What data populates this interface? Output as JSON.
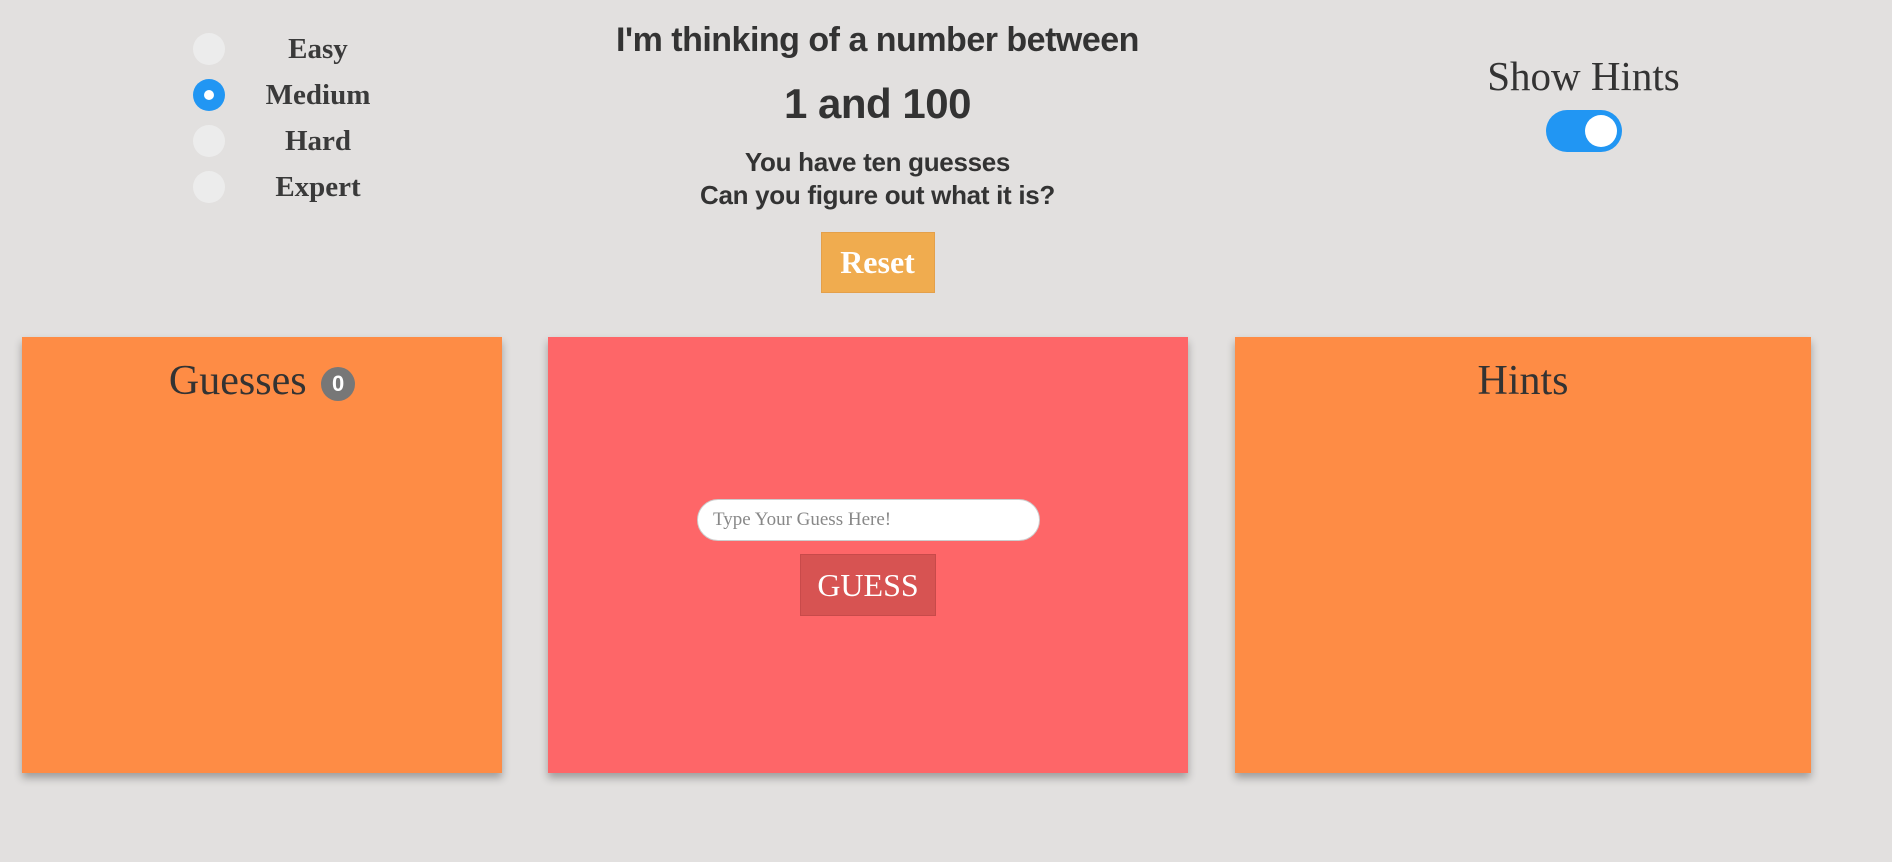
{
  "difficulty": {
    "options": [
      {
        "label": "Easy",
        "checked": false
      },
      {
        "label": "Medium",
        "checked": true
      },
      {
        "label": "Hard",
        "checked": false
      },
      {
        "label": "Expert",
        "checked": false
      }
    ]
  },
  "header": {
    "line1": "I'm thinking of a number between",
    "range": "1 and 100",
    "sub1": "You have ten guesses",
    "sub2": "Can you figure out what it is?",
    "reset_label": "Reset"
  },
  "hints_toggle": {
    "label": "Show Hints",
    "on": true
  },
  "guesses_panel": {
    "title": "Guesses",
    "count": "0"
  },
  "guess_panel": {
    "placeholder": "Type Your Guess Here!",
    "value": "",
    "button_label": "GUESS"
  },
  "hints_panel": {
    "title": "Hints"
  },
  "colors": {
    "background": "#e2e0df",
    "accent": "#2196f3",
    "panel_orange": "#fe8c45",
    "panel_red": "#fe6668",
    "reset": "#f0ac4f",
    "guess_button": "#d75352"
  }
}
